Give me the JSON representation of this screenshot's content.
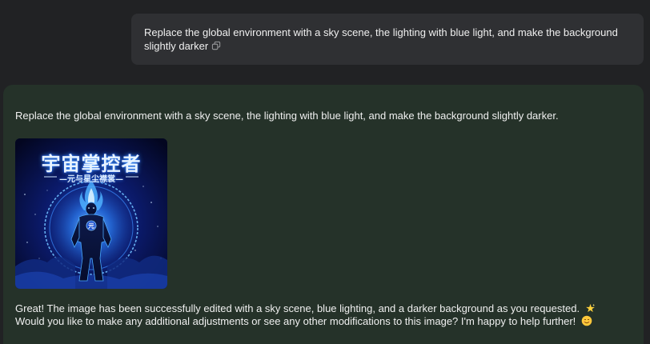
{
  "user_message": {
    "text": "Replace the global environment with a sky scene, the lighting with blue light, and make the background slightly darker",
    "copy_icon": "copy-icon"
  },
  "assistant": {
    "intro": "Replace the global environment with a sky scene, the lighting with blue light, and make the background slightly darker.",
    "image": {
      "title": "宇宙掌控者",
      "subtitle": "—元与星尘襟裳—",
      "chest_mark": "元"
    },
    "reply_line1": "Great! The image has been successfully edited with a sky scene, blue lighting, and a darker background as you requested.",
    "reply_line2": "Would you like to make any additional adjustments or see any other modifications to this image? I'm happy to help further!",
    "star_icon": "star-icon",
    "smile_icon": "smiling-face-icon"
  },
  "colors": {
    "page_bg": "#212224",
    "user_bubble_bg": "#2f3033",
    "assistant_bg": "#253229",
    "accent_blue": "#2f8cff"
  }
}
